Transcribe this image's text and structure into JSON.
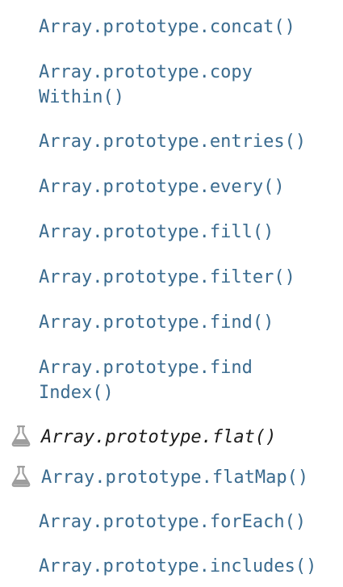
{
  "sidebar": {
    "items": [
      {
        "label": "Array.prototype.concat()",
        "experimental": false,
        "current": false
      },
      {
        "label": "Array.prototype.copy\nWithin()",
        "experimental": false,
        "current": false
      },
      {
        "label": "Array.prototype.entries()",
        "experimental": false,
        "current": false
      },
      {
        "label": "Array.prototype.every()",
        "experimental": false,
        "current": false
      },
      {
        "label": "Array.prototype.fill()",
        "experimental": false,
        "current": false
      },
      {
        "label": "Array.prototype.filter()",
        "experimental": false,
        "current": false
      },
      {
        "label": "Array.prototype.find()",
        "experimental": false,
        "current": false
      },
      {
        "label": "Array.prototype.find\nIndex()",
        "experimental": false,
        "current": false
      },
      {
        "label": "Array.prototype.flat()",
        "experimental": true,
        "current": true,
        "icon": "flask-icon"
      },
      {
        "label": "Array.prototype.flatMap()",
        "experimental": true,
        "current": false,
        "icon": "flask-icon"
      },
      {
        "label": "Array.prototype.forEach()",
        "experimental": false,
        "current": false
      },
      {
        "label": "Array.prototype.includes()",
        "experimental": false,
        "current": false
      }
    ]
  },
  "colors": {
    "link": "#3a6b8f",
    "current": "#1b1b1b",
    "icon": "#9e9e9e"
  }
}
